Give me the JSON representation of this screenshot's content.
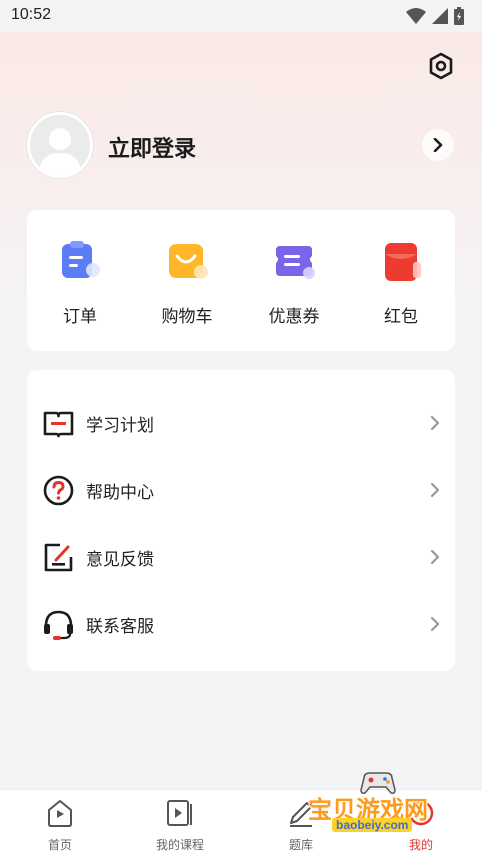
{
  "status_bar": {
    "time": "10:52",
    "icons": [
      "wifi-icon",
      "signal-icon",
      "battery-icon"
    ]
  },
  "header": {
    "settings_icon": "settings-icon"
  },
  "profile": {
    "login_label": "立即登录",
    "avatar_icon": "avatar-placeholder-icon",
    "arrow_icon": "chevron-right-icon"
  },
  "quick_actions": [
    {
      "label": "订单",
      "icon": "order-icon",
      "color": "#5b7cf5"
    },
    {
      "label": "购物车",
      "icon": "cart-icon",
      "color": "#ffb628"
    },
    {
      "label": "优惠券",
      "icon": "coupon-icon",
      "color": "#7b64e8"
    },
    {
      "label": "红包",
      "icon": "red-packet-icon",
      "color": "#ee3b32"
    }
  ],
  "menu": [
    {
      "label": "学习计划",
      "icon": "study-plan-icon"
    },
    {
      "label": "帮助中心",
      "icon": "help-center-icon"
    },
    {
      "label": "意见反馈",
      "icon": "feedback-icon"
    },
    {
      "label": "联系客服",
      "icon": "customer-service-icon"
    }
  ],
  "bottom_nav": [
    {
      "label": "首页",
      "icon": "home-icon",
      "active": false
    },
    {
      "label": "我的课程",
      "icon": "my-courses-icon",
      "active": false
    },
    {
      "label": "题库",
      "icon": "question-bank-icon",
      "active": false
    },
    {
      "label": "我的",
      "icon": "profile-icon",
      "active": true
    }
  ],
  "watermark": {
    "title": "宝贝游戏网",
    "url": "baobeiy.com"
  },
  "colors": {
    "accent": "#e0352b",
    "background": "#f4f4f6"
  }
}
